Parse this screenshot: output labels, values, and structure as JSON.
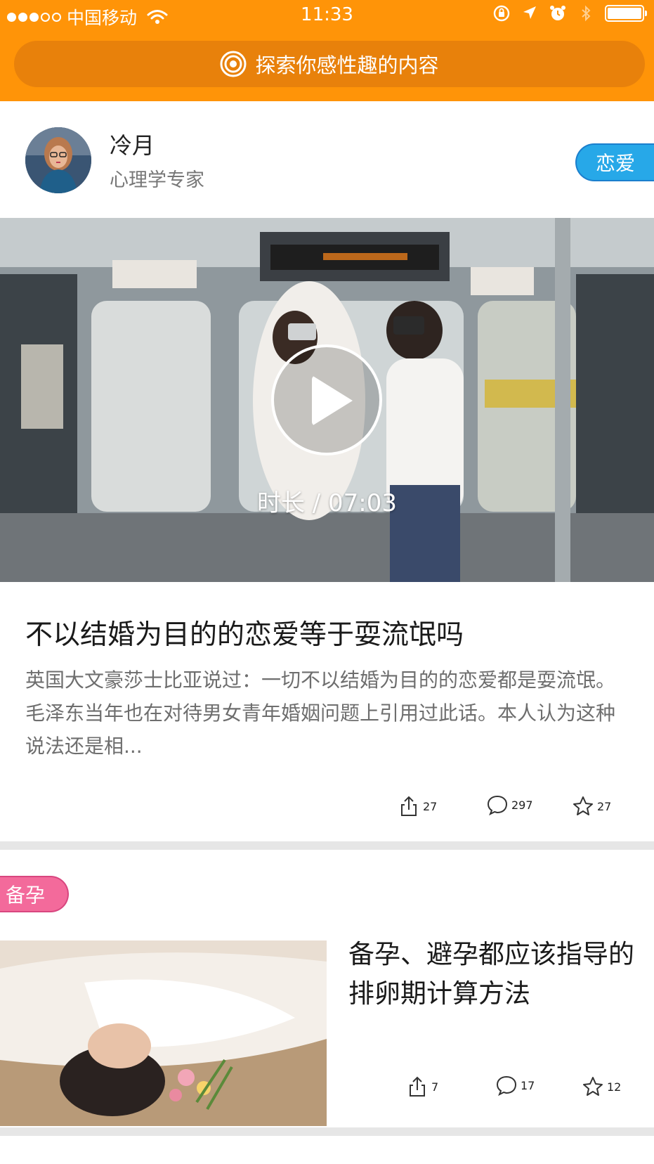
{
  "status_bar": {
    "carrier": "中国移动",
    "time": "11:33",
    "signal_bars_filled": 3,
    "signal_bars_total": 5
  },
  "header": {
    "explore_label": "探索你感性趣的内容",
    "bg_color": "#ff9408"
  },
  "feed": {
    "card1": {
      "author_name": "冷月",
      "author_title": "心理学专家",
      "category_tag": "恋爱",
      "duration_label": "时长 / 07:03",
      "title": "不以结婚为目的的恋爱等于耍流氓吗",
      "excerpt": "英国大文豪莎士比亚说过：一切不以结婚为目的的恋爱都是耍流氓。 毛泽东当年也在对待男女青年婚姻问题上引用过此话。本人认为这种说法还是相...",
      "shares": "27",
      "comments": "297",
      "favorites": "27"
    },
    "card2": {
      "category_tag": "备孕",
      "title": "备孕、避孕都应该指导的排卵期计算方法",
      "shares": "7",
      "comments": "17",
      "favorites": "12"
    }
  },
  "icons": {
    "share": "share-icon",
    "comment": "comment-icon",
    "favorite": "star-icon",
    "play": "play-icon",
    "explore": "target-icon"
  }
}
